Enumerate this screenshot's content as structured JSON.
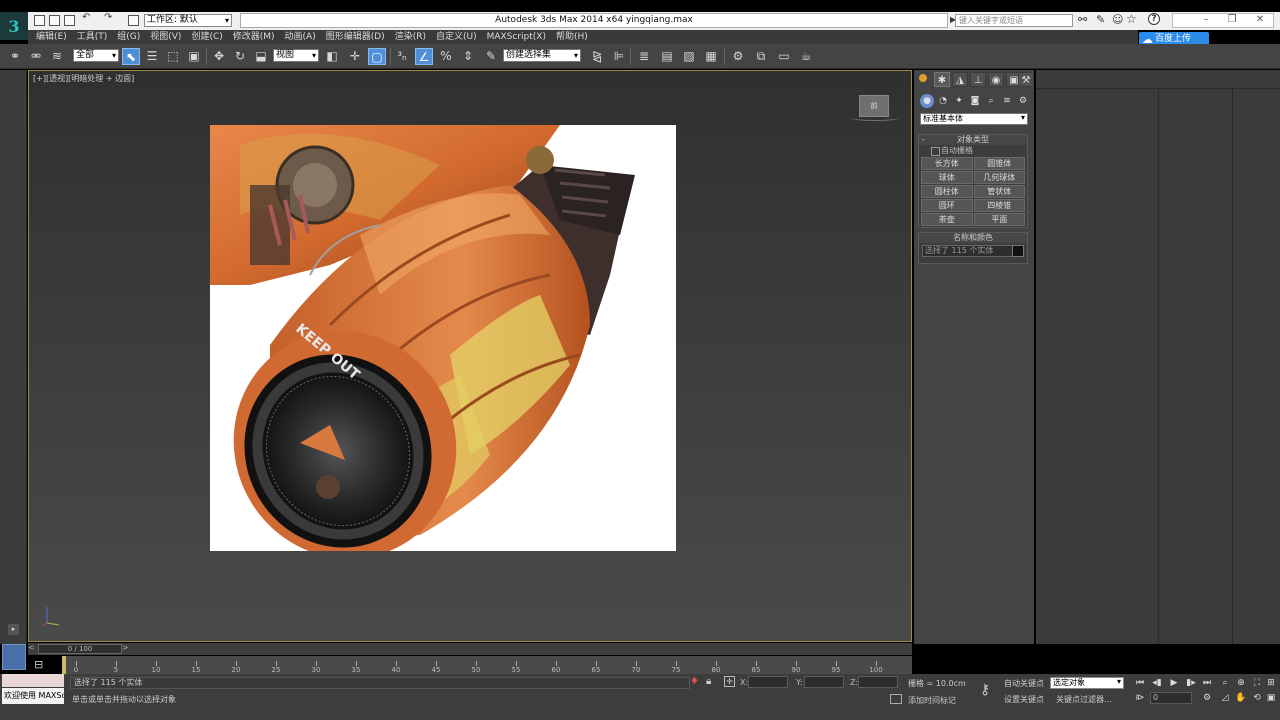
{
  "app": {
    "title": "Autodesk 3ds Max  2014 x64     yingqiang.max",
    "workspace": "工作区: 默认",
    "search_placeholder": "键入关键字或短语",
    "logo_letter": "3"
  },
  "cloud_upload": "百度上传",
  "menu": [
    "编辑(E)",
    "工具(T)",
    "组(G)",
    "视图(V)",
    "创建(C)",
    "修改器(M)",
    "动画(A)",
    "图形编辑器(D)",
    "渲染(R)",
    "自定义(U)",
    "MAXScript(X)",
    "帮助(H)"
  ],
  "toolbar": {
    "filter_select": "全部",
    "ref_coord_select": "视图",
    "named_selection": "创建选择集"
  },
  "viewport": {
    "label": "[+][透视][明暗处理 + 边面]",
    "viewcube_label": "前",
    "render_text": "KEEP OUT"
  },
  "command_panel": {
    "category": "标准基本体",
    "object_type_header": "对象类型",
    "auto_grid": "自动栅格",
    "objects": [
      "长方体",
      "圆锥体",
      "球体",
      "几何球体",
      "圆柱体",
      "管状体",
      "圆环",
      "四棱锥",
      "茶壶",
      "平面"
    ],
    "name_color_header": "名称和颜色",
    "name_value": "选择了 115 个实体"
  },
  "timeline": {
    "frame_display": "0 / 100",
    "ticks": [
      "0",
      "5",
      "10",
      "15",
      "20",
      "25",
      "30",
      "35",
      "40",
      "45",
      "50",
      "55",
      "60",
      "65",
      "70",
      "75",
      "80",
      "85",
      "90",
      "95",
      "100"
    ]
  },
  "statusbar": {
    "welcome": "欢迎使用 MAXSc",
    "selection_status": "选择了 115 个实体",
    "prompt": "单击或单击并拖动以选择对象",
    "x_label": "X:",
    "y_label": "Y:",
    "z_label": "Z:",
    "grid": "栅格 = 10.0cm",
    "add_time_tag": "添加时间标记",
    "auto_key": "自动关键点",
    "set_key": "设置关键点",
    "selected_object": "选定对象",
    "key_filters": "关键点过滤器...",
    "current_frame": "0"
  },
  "colors": {
    "accent": "#4f8fd8",
    "viewport_border": "#a08a40",
    "cloud_button": "#2b8bea"
  }
}
